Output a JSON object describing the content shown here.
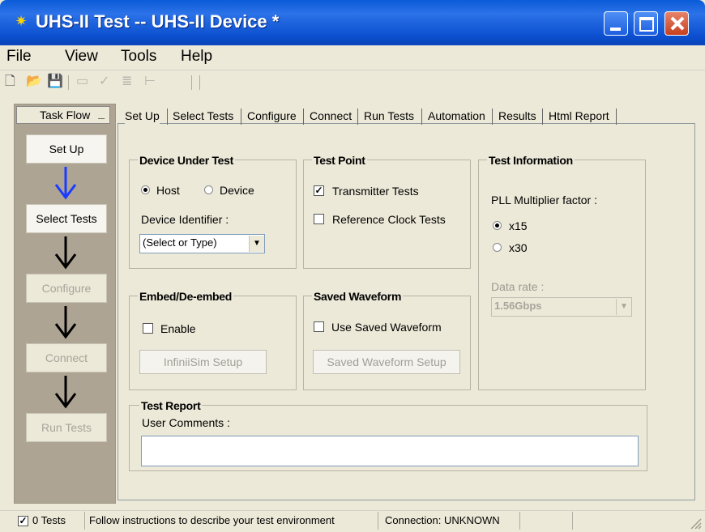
{
  "window": {
    "title": "UHS-II Test -- UHS-II Device *"
  },
  "menu": [
    "File",
    "View",
    "Tools",
    "Help"
  ],
  "taskflow": {
    "header": "Task Flow",
    "steps": [
      "Set Up",
      "Select Tests",
      "Configure",
      "Connect",
      "Run Tests"
    ]
  },
  "tabs": [
    "Set Up",
    "Select Tests",
    "Configure",
    "Connect",
    "Run Tests",
    "Automation",
    "Results",
    "Html Report"
  ],
  "dut": {
    "title": "Device Under Test",
    "host": "Host",
    "device": "Device",
    "identifier_label": "Device Identifier :",
    "identifier_value": "(Select or Type)"
  },
  "test_point": {
    "title": "Test Point",
    "transmitter": "Transmitter Tests",
    "reference": "Reference Clock Tests"
  },
  "test_info": {
    "title": "Test Information",
    "pll_label": "PLL Multiplier factor :",
    "x15": "x15",
    "x30": "x30",
    "data_rate_label": "Data rate :",
    "data_rate_value": "1.56Gbps"
  },
  "embed": {
    "title": "Embed/De-embed",
    "enable": "Enable",
    "setup_button": "InfiniiSim Setup"
  },
  "saved_waveform": {
    "title": "Saved Waveform",
    "use": "Use Saved Waveform",
    "setup_button": "Saved Waveform Setup"
  },
  "report": {
    "title": "Test Report",
    "comments_label": "User Comments :"
  },
  "status": {
    "tests": "0 Tests",
    "message": "Follow instructions to describe your test environment",
    "connection": "Connection: UNKNOWN"
  }
}
